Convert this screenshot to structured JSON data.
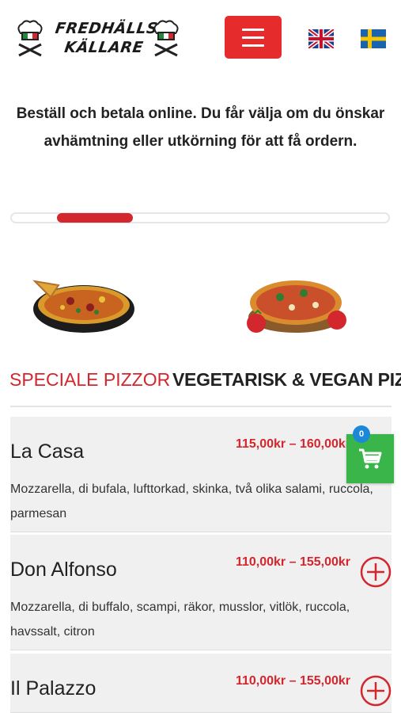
{
  "brand": {
    "logo_text_line1": "FREDHÄLLS",
    "logo_text_line2": "KÄLLARE"
  },
  "header": {
    "menu_icon": "hamburger-icon",
    "languages": [
      "english-flag",
      "swedish-flag"
    ]
  },
  "intro": {
    "text": "Beställ och betala online. Du får välja om du önskar avhämtning eller utkörning för att få ordern."
  },
  "tabs": [
    {
      "label": "SPECIALE PIZZOR",
      "active": true
    },
    {
      "label": "VEGETARISK & VEGAN PIZ",
      "active": false
    }
  ],
  "products": [
    {
      "name": "La Casa",
      "price": "115,00kr – 160,00kr",
      "description": "Mozzarella, di bufala, lufttorkad, skinka, två olika salami, ruccola, parmesan"
    },
    {
      "name": "Don Alfonso",
      "price": "110,00kr – 155,00kr",
      "description": "Mozzarella, di buffalo, scampi, räkor, musslor, vitlök, ruccola, havssalt, citron"
    },
    {
      "name": "Il Palazzo",
      "price": "110,00kr – 155,00kr",
      "description": ""
    }
  ],
  "cart": {
    "count": "0",
    "icon": "cart-icon"
  },
  "colors": {
    "accent": "#d3262d",
    "menu_button": "#e52b2b",
    "cart": "#39b54a",
    "badge": "#1e88d8"
  }
}
